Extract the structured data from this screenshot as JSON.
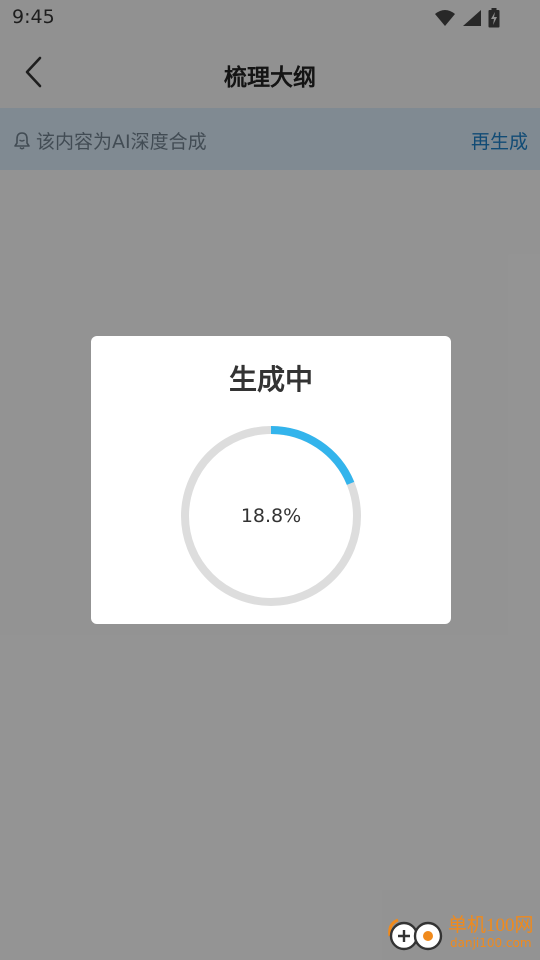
{
  "status_bar": {
    "time": "9:45",
    "icons": [
      "wifi-icon",
      "cell-signal-icon",
      "battery-charging-icon"
    ]
  },
  "header": {
    "title": "梳理大纲",
    "back_icon": "chevron-left-icon"
  },
  "notice": {
    "icon": "bell-icon",
    "text": "该内容为AI深度合成",
    "action_label": "再生成"
  },
  "dialog": {
    "title": "生成中",
    "progress": {
      "value": 18.8,
      "label": "18.8%"
    },
    "colors": {
      "progress_fill": "#33b4ec",
      "progress_track": "#dddddd"
    }
  },
  "watermark": {
    "name": "单机100网",
    "domain": "danji100.com"
  },
  "colors": {
    "accent_link": "#1d7ec4",
    "notice_bg": "#d6e6f3",
    "watermark": "#f08a1c"
  }
}
